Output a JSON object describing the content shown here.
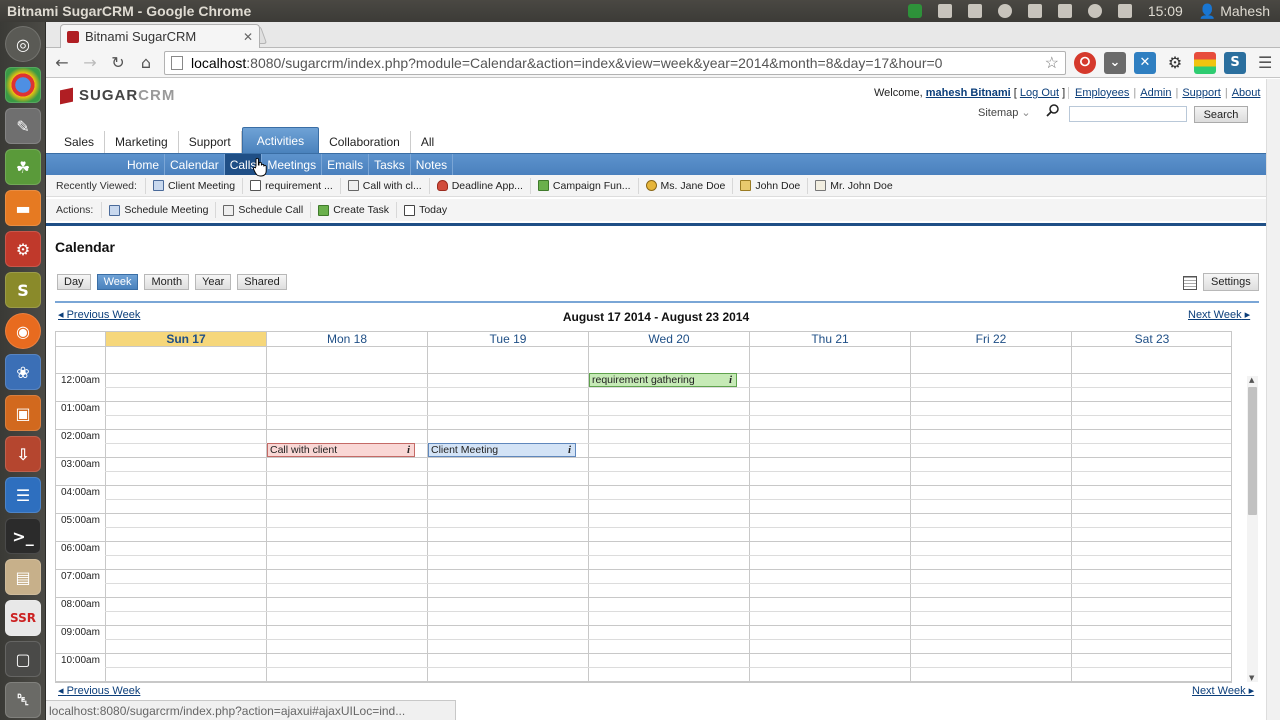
{
  "os": {
    "window_title": "Bitnami SugarCRM - Google Chrome",
    "clock": "15:09",
    "user": "Mahesh"
  },
  "browser": {
    "tab_title": "Bitnami SugarCRM",
    "url_host": "localhost",
    "url_rest": ":8080/sugarcrm/index.php?module=Calendar&action=index&view=week&year=2014&month=8&day=17&hour=0",
    "status_url": "localhost:8080/sugarcrm/index.php?action=ajaxui#ajaxUILoc=ind..."
  },
  "header": {
    "logo_main": "SUGAR",
    "logo_sub": "CRM",
    "welcome": "Welcome,",
    "username": "mahesh Bitnami",
    "logout": "Log Out",
    "links": [
      "Employees",
      "Admin",
      "Support",
      "About"
    ],
    "sitemap": "Sitemap",
    "search_button": "Search"
  },
  "module_tabs": [
    "Sales",
    "Marketing",
    "Support",
    "Activities",
    "Collaboration",
    "All"
  ],
  "active_module": "Activities",
  "sub_nav": [
    "Home",
    "Calendar",
    "Calls",
    "Meetings",
    "Emails",
    "Tasks",
    "Notes"
  ],
  "recent": {
    "label": "Recently Viewed:",
    "items": [
      {
        "label": "Client Meeting",
        "icon": "meeting-icon"
      },
      {
        "label": "requirement ...",
        "icon": "task-icon"
      },
      {
        "label": "Call with cl...",
        "icon": "call-icon"
      },
      {
        "label": "Deadline App...",
        "icon": "opportunity-icon"
      },
      {
        "label": "Campaign Fun...",
        "icon": "campaign-icon"
      },
      {
        "label": "Ms. Jane Doe",
        "icon": "contact-icon"
      },
      {
        "label": "John Doe",
        "icon": "account-icon"
      },
      {
        "label": "Mr. John Doe",
        "icon": "lead-icon"
      }
    ]
  },
  "actions": {
    "label": "Actions:",
    "items": [
      {
        "label": "Schedule Meeting",
        "icon": "meeting-icon"
      },
      {
        "label": "Schedule Call",
        "icon": "call-icon"
      },
      {
        "label": "Create Task",
        "icon": "task-icon"
      },
      {
        "label": "Today",
        "icon": "calendar-icon"
      }
    ]
  },
  "calendar": {
    "title": "Calendar",
    "views": [
      "Day",
      "Week",
      "Month",
      "Year",
      "Shared"
    ],
    "active_view": "Week",
    "settings": "Settings",
    "prev_week": "Previous Week",
    "next_week": "Next Week",
    "range": "August 17 2014 - August 23 2014",
    "days": [
      "Sun 17",
      "Mon 18",
      "Tue 19",
      "Wed 20",
      "Thu 21",
      "Fri 22",
      "Sat 23"
    ],
    "today_index": 0,
    "hours": [
      "12:00am",
      "01:00am",
      "02:00am",
      "03:00am",
      "04:00am",
      "05:00am",
      "06:00am",
      "07:00am",
      "08:00am",
      "09:00am",
      "10:00am"
    ],
    "events": [
      {
        "title": "requirement gathering",
        "type": "task",
        "day": "Wed 20",
        "start": "12:00am"
      },
      {
        "title": "Call with client",
        "type": "call",
        "day": "Mon 18",
        "start": "02:30am"
      },
      {
        "title": "Client Meeting",
        "type": "mtg",
        "day": "Tue 19",
        "start": "02:30am"
      }
    ],
    "event_info_glyph": "i"
  }
}
